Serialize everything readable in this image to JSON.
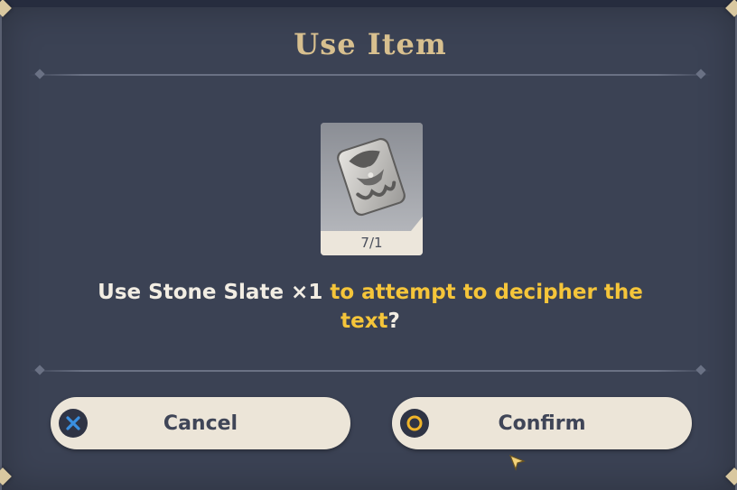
{
  "dialog": {
    "title": "Use Item",
    "item": {
      "name": "Stone Slate",
      "icon": "stone-slate-icon",
      "count_label": "7/1"
    },
    "prompt": {
      "part1": "Use Stone Slate ×1 ",
      "highlight": "to attempt to decipher the text",
      "part2": "?"
    },
    "buttons": {
      "cancel": {
        "label": "Cancel",
        "icon": "cross-button-icon",
        "icon_color": "#3a8fe0"
      },
      "confirm": {
        "label": "Confirm",
        "icon": "circle-button-icon",
        "icon_color": "#f0b429"
      }
    }
  },
  "colors": {
    "title": "#d8c08f",
    "highlight": "#f5c53a",
    "panel": "#3b4254",
    "button": "#ece5d8"
  }
}
